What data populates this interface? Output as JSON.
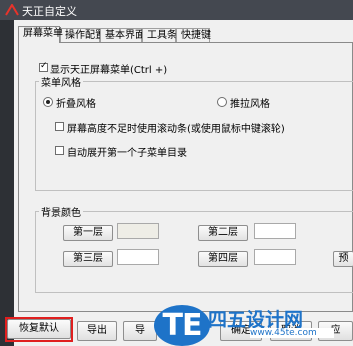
{
  "window": {
    "title": "天正自定义"
  },
  "tabs": [
    {
      "label": "屏幕菜单"
    },
    {
      "label": "操作配置"
    },
    {
      "label": "基本界面"
    },
    {
      "label": "工具条"
    },
    {
      "label": "快捷键"
    }
  ],
  "screen_menu": {
    "show_checkbox_label": "显示天正屏幕菜单(Ctrl +)",
    "show_checked": true,
    "menu_style_group": "菜单风格",
    "style_options": [
      {
        "label": "折叠风格",
        "selected": true
      },
      {
        "label": "推拉风格",
        "selected": false
      }
    ],
    "scroll_checkbox_label": "屏幕高度不足时使用滚动条(或使用鼠标中键滚轮)",
    "scroll_checked": false,
    "auto_expand_label": "自动展开第一个子菜单目录",
    "auto_expand_checked": false,
    "bg_color_group": "背景颜色",
    "levels": [
      {
        "label": "第一层"
      },
      {
        "label": "第二层"
      },
      {
        "label": "第三层"
      },
      {
        "label": "第四层"
      },
      {
        "label": "预"
      }
    ]
  },
  "footer": {
    "restore_default": "恢复默认",
    "export": "导出",
    "import": "导",
    "ok": "确定",
    "cancel": "取消",
    "apply": "应"
  },
  "watermark": {
    "badge": "TE",
    "text": "四五设计网",
    "url": "www.45te.com"
  },
  "colors": {
    "accent": "#1e73c8",
    "highlight": "#e01f1f",
    "swatch_level1": "#eeede6",
    "swatch_default": "#ffffff"
  }
}
